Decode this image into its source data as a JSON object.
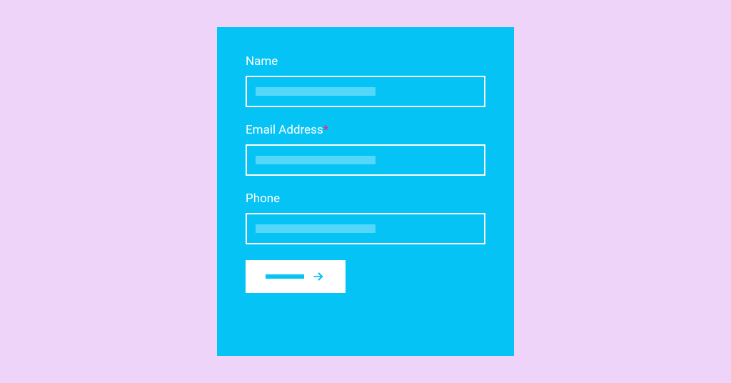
{
  "form": {
    "fields": [
      {
        "label": "Name",
        "required": false
      },
      {
        "label": "Email Address",
        "required": true
      },
      {
        "label": "Phone",
        "required": false
      }
    ],
    "required_marker": "*"
  }
}
